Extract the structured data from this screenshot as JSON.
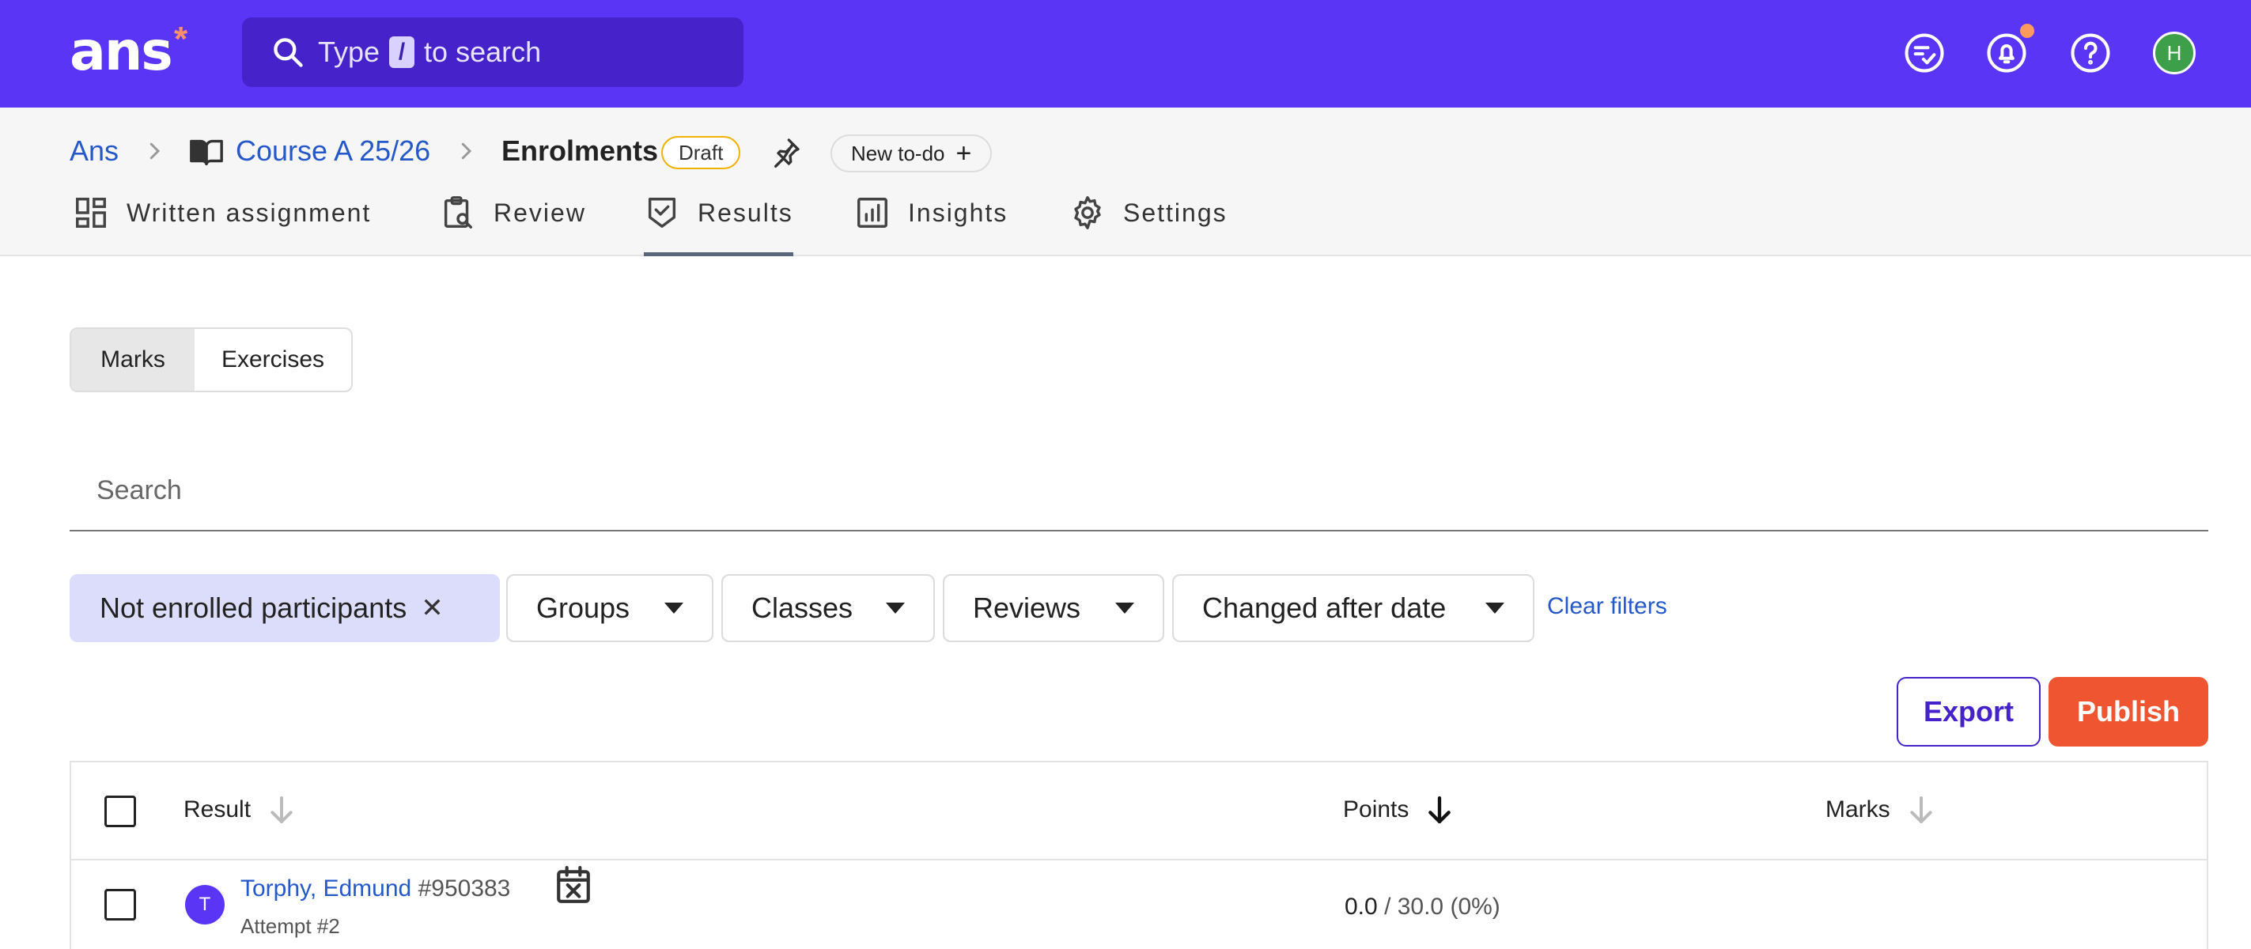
{
  "topbar": {
    "logo": "ans",
    "logo_mark": "*",
    "search": {
      "prefix": "Type",
      "key": "/",
      "suffix": "to search"
    },
    "icons": [
      "tasks-icon",
      "bell-icon",
      "help-icon"
    ],
    "avatar_initial": "H",
    "colors": {
      "bar": "#5a35f5",
      "search": "#4522c9",
      "notification": "#ff9a5e",
      "avatar": "#3e9f4a"
    }
  },
  "breadcrumb": {
    "root": "Ans",
    "course": "Course A 25/26",
    "current": "Enrolments",
    "status": "Draft",
    "new_todo": "New to-do"
  },
  "tabs": [
    {
      "label": "Written assignment",
      "icon": "layout-icon"
    },
    {
      "label": "Review",
      "icon": "clipboard-search-icon"
    },
    {
      "label": "Results",
      "icon": "shield-check-icon",
      "active": true
    },
    {
      "label": "Insights",
      "icon": "bar-chart-icon"
    },
    {
      "label": "Settings",
      "icon": "gear-icon"
    }
  ],
  "view_toggle": {
    "options": [
      "Marks",
      "Exercises"
    ],
    "selected": "Marks"
  },
  "search": {
    "placeholder": "Search",
    "value": ""
  },
  "filters": {
    "active": "Not enrolled participants",
    "dropdowns": [
      "Groups",
      "Classes",
      "Reviews",
      "Changed after date"
    ],
    "clear": "Clear filters"
  },
  "actions": {
    "export": "Export",
    "publish": "Publish",
    "publish_color": "#ee5530"
  },
  "table": {
    "columns": [
      {
        "label": "Result",
        "sort": "inactive"
      },
      {
        "label": "Points",
        "sort": "desc"
      },
      {
        "label": "Marks",
        "sort": "inactive"
      }
    ],
    "rows": [
      {
        "avatar": "T",
        "name": "Torphy, Edmund",
        "number": "#950383",
        "attempt": "Attempt #2",
        "status_icon": "calendar-x-icon",
        "points_earned": "0.0",
        "points_total": "/ 30.0 (0%)",
        "marks": ""
      }
    ]
  }
}
